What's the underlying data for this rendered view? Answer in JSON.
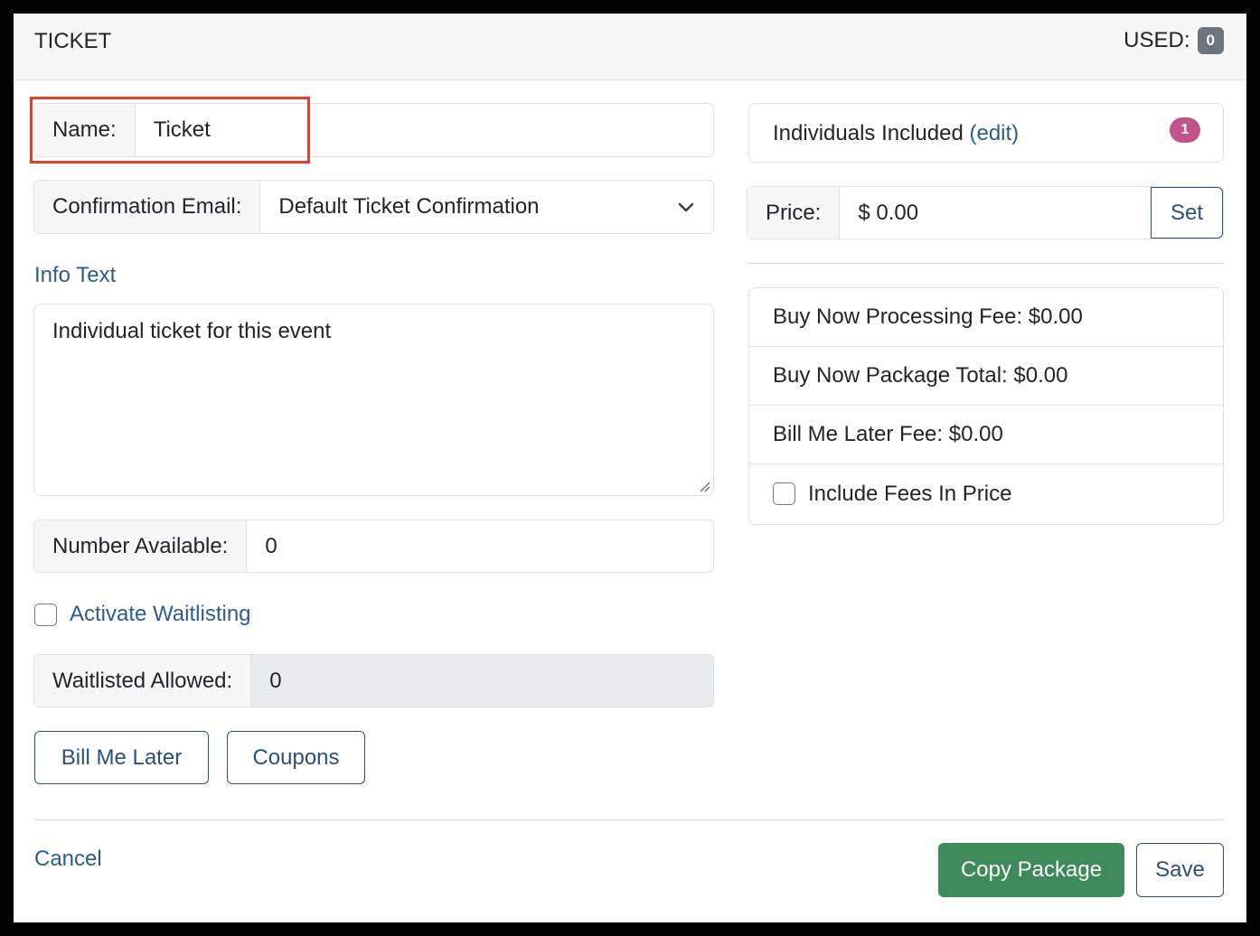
{
  "header": {
    "title": "TICKET",
    "used_label": "USED:",
    "used_count": "0"
  },
  "form": {
    "name_label": "Name:",
    "name_value": "Ticket",
    "confirmation_label": "Confirmation Email:",
    "confirmation_value": "Default Ticket Confirmation",
    "info_text_label": "Info Text",
    "info_text_value": "Individual ticket for this event",
    "number_available_label": "Number Available:",
    "number_available_value": "0",
    "activate_waitlisting_label": "Activate Waitlisting",
    "waitlisted_allowed_label": "Waitlisted Allowed:",
    "waitlisted_allowed_value": "0",
    "bill_me_later_button": "Bill Me Later",
    "coupons_button": "Coupons"
  },
  "right": {
    "individuals_label": "Individuals Included",
    "individuals_edit": "(edit)",
    "individuals_count": "1",
    "price_label": "Price:",
    "price_value": "$ 0.00",
    "price_set_button": "Set",
    "fees": [
      "Buy Now Processing Fee: $0.00",
      "Buy Now Package Total: $0.00",
      "Bill Me Later Fee: $0.00"
    ],
    "include_fees_label": "Include Fees In Price"
  },
  "footer": {
    "cancel_label": "Cancel",
    "copy_package_label": "Copy Package",
    "save_label": "Save"
  },
  "colors": {
    "link": "#2f5b8f",
    "primary_green": "#3d8a5a",
    "badge_gray": "#6c757d",
    "badge_pink": "#c0548a",
    "highlight_red": "#e0432d"
  }
}
